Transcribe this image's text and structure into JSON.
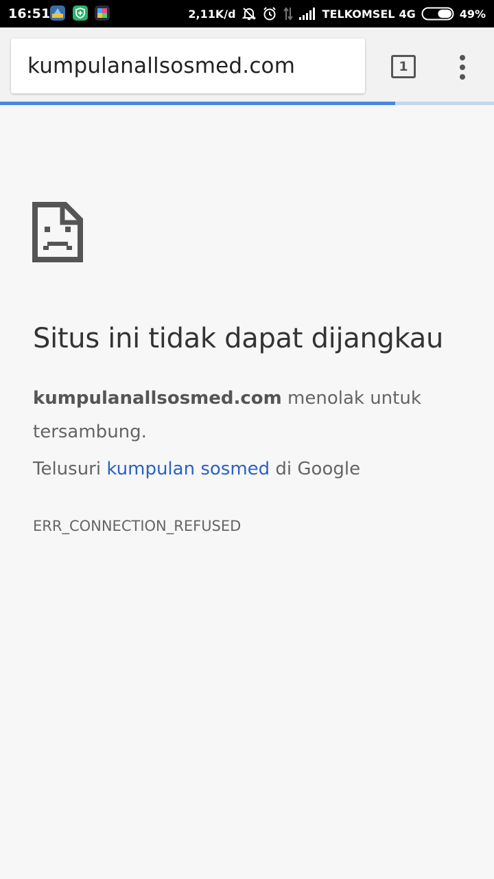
{
  "status_bar": {
    "time": "16:51",
    "net_speed": "2,11K/d",
    "carrier": "TELKOMSEL",
    "network_type": "4G",
    "battery_percent": "49%",
    "battery_level": 0.49,
    "icons": [
      "photo-app-icon",
      "shield-app-icon",
      "puzzle-app-icon",
      "mute-icon",
      "alarm-icon",
      "data-transfer-icon",
      "signal-icon",
      "battery-icon"
    ]
  },
  "toolbar": {
    "url": "kumpulanallsosmed.com",
    "tab_count": "1",
    "page_load_progress": 0.8
  },
  "error": {
    "title": "Situs ini tidak dapat dijangkau",
    "site": "kumpulanallsosmed.com",
    "message": " menolak untuk tersambung.",
    "suggest_prefix": "Telusuri ",
    "suggest_link": "kumpulan sosmed",
    "suggest_suffix": " di Google",
    "code": "ERR_CONNECTION_REFUSED"
  },
  "colors": {
    "link": "#2a62c2",
    "progress": "#4a86e0",
    "background": "#f7f7f7"
  }
}
